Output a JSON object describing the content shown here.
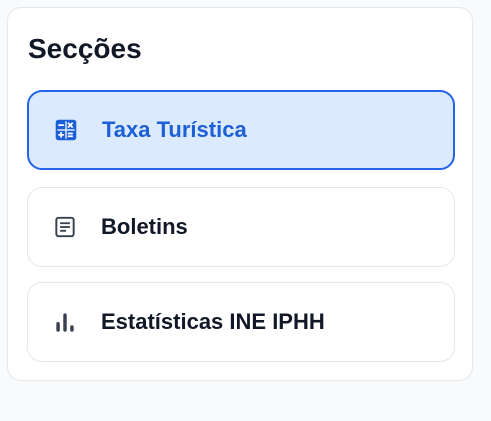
{
  "sections": {
    "title": "Secções",
    "items": [
      {
        "label": "Taxa Turística",
        "icon": "calculator-icon",
        "active": true
      },
      {
        "label": "Boletins",
        "icon": "document-icon",
        "active": false
      },
      {
        "label": "Estatísticas INE IPHH",
        "icon": "bar-chart-icon",
        "active": false
      }
    ]
  },
  "colors": {
    "accent": "#2563eb",
    "active_background": "#dbeafe",
    "text": "#111827"
  }
}
